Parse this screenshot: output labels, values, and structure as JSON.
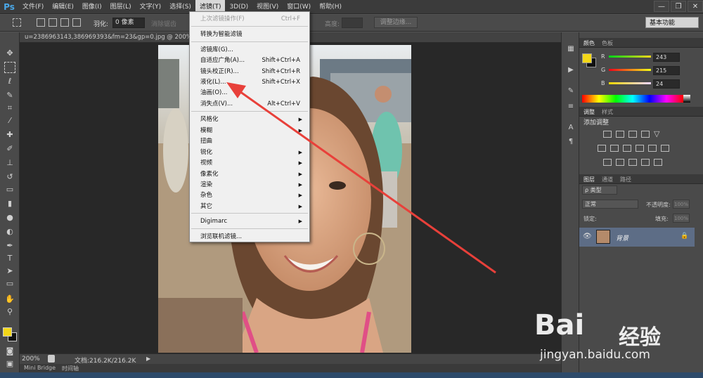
{
  "app": {
    "logo": "Ps"
  },
  "menubar": {
    "items": [
      "文件(F)",
      "编辑(E)",
      "图像(I)",
      "图层(L)",
      "文字(Y)",
      "选择(S)",
      "滤镜(T)",
      "3D(D)",
      "视图(V)",
      "窗口(W)",
      "帮助(H)"
    ],
    "active": "滤镜(T)"
  },
  "window_controls": {
    "minimize": "—",
    "restore": "❐",
    "close": "✕"
  },
  "options": {
    "feather_label": "羽化:",
    "feather_value": "0 像素",
    "antialias": "消除锯齿",
    "height_label": "高度:",
    "refine_edge": "调整边缘...",
    "workspace": "基本功能"
  },
  "document": {
    "tab_title": "u=2386963143,386969393&fm=23&gp=0.jpg @ 200%(R...",
    "zoom": "200%",
    "doc_info": "文档:216.2K/216.2K"
  },
  "bottom_tabs": [
    "Mini Bridge",
    "时间轴"
  ],
  "filter_menu": {
    "items": [
      {
        "label": "上次滤镜操作(F)",
        "shortcut": "Ctrl+F",
        "disabled": true
      },
      {
        "label": "转换为智能滤镜",
        "shortcut": ""
      },
      {
        "label": "滤镜库(G)...",
        "shortcut": ""
      },
      {
        "label": "自适应广角(A)...",
        "shortcut": "Shift+Ctrl+A"
      },
      {
        "label": "镜头校正(R)...",
        "shortcut": "Shift+Ctrl+R"
      },
      {
        "label": "液化(L)...",
        "shortcut": "Shift+Ctrl+X"
      },
      {
        "label": "油画(O)...",
        "shortcut": ""
      },
      {
        "label": "消失点(V)...",
        "shortcut": "Alt+Ctrl+V"
      },
      {
        "label": "风格化",
        "submenu": true
      },
      {
        "label": "模糊",
        "submenu": true
      },
      {
        "label": "扭曲",
        "submenu": true
      },
      {
        "label": "锐化",
        "submenu": true
      },
      {
        "label": "视频",
        "submenu": true
      },
      {
        "label": "像素化",
        "submenu": true
      },
      {
        "label": "渲染",
        "submenu": true
      },
      {
        "label": "杂色",
        "submenu": true
      },
      {
        "label": "其它",
        "submenu": true
      },
      {
        "label": "Digimarc",
        "submenu": true
      },
      {
        "label": "浏览联机滤镜..."
      }
    ]
  },
  "color_panel": {
    "tabs": [
      "颜色",
      "色板"
    ],
    "r_label": "R",
    "g_label": "G",
    "b_label": "B",
    "r": "243",
    "g": "215",
    "b": "24",
    "fg_color": "#f3d718",
    "bg_color": "#111111"
  },
  "adjust_panel": {
    "tabs": [
      "调整",
      "样式"
    ],
    "title": "添加调整"
  },
  "layers_panel": {
    "tabs": [
      "图层",
      "通道",
      "路径"
    ],
    "filter_type": "ρ 类型",
    "blend_mode": "正常",
    "opacity_label": "不透明度:",
    "opacity_value": "100%",
    "lock_label": "锁定:",
    "fill_label": "填充:",
    "fill_value": "100%",
    "layer_name": "背景"
  },
  "watermark": {
    "brand": "Bai",
    "brand2": "经验",
    "url": "jingyan.baidu.com"
  },
  "accent_colors": {
    "arrow": "#e8403a",
    "selection": "#5d6d86"
  }
}
